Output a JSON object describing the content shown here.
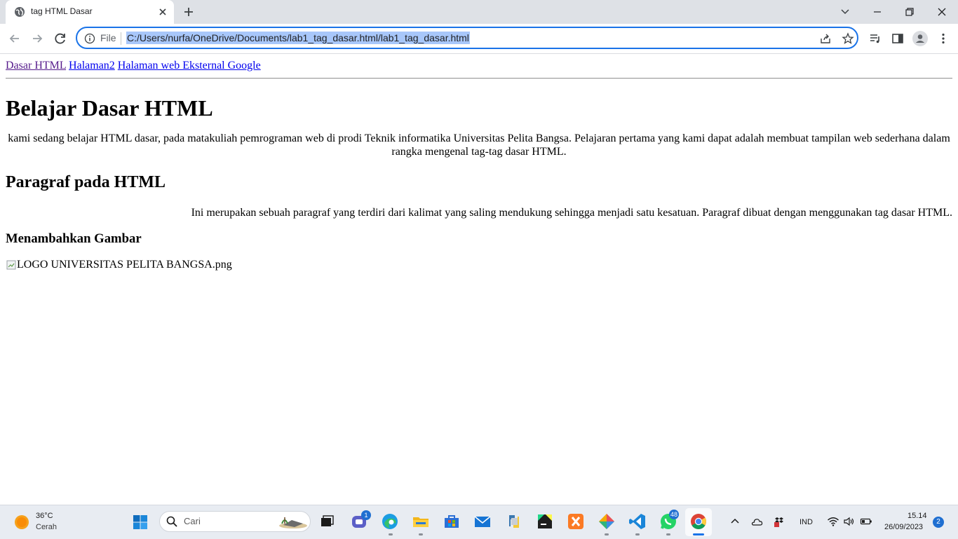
{
  "browser": {
    "tab_title": "tag HTML Dasar",
    "url_scheme": "File",
    "url": "C:/Users/nurfa/OneDrive/Documents/lab1_tag_dasar.html/lab1_tag_dasar.html"
  },
  "page": {
    "nav_links": [
      {
        "label": "Dasar HTML"
      },
      {
        "label": "Halaman2"
      },
      {
        "label": "Halaman web Eksternal Google"
      }
    ],
    "heading": "Belajar Dasar HTML",
    "intro": "kami sedang belajar HTML dasar, pada matakuliah pemrograman web di prodi Teknik informatika Universitas Pelita Bangsa. Pelajaran pertama yang kami dapat adalah membuat tampilan web sederhana dalam rangka mengenal tag-tag dasar HTML.",
    "section_title": "Paragraf pada HTML",
    "section_text": "Ini merupakan sebuah paragraf yang terdiri dari kalimat yang saling mendukung sehingga menjadi satu kesatuan. Paragraf dibuat dengan menggunakan tag dasar HTML.",
    "image_title": "Menambahkan Gambar",
    "image_alt": "LOGO UNIVERSITAS PELITA BANGSA.png"
  },
  "taskbar": {
    "weather_temp": "36°C",
    "weather_desc": "Cerah",
    "search_placeholder": "Cari",
    "teams_badge": "1",
    "whatsapp_badge": "48",
    "language": "IND",
    "time": "15.14",
    "date": "26/09/2023",
    "notification_count": "2"
  },
  "colors": {
    "accent": "#1a73e8",
    "link": "#0000ee",
    "visited_link": "#551a8b",
    "url_highlight": "#a8c7fa"
  }
}
